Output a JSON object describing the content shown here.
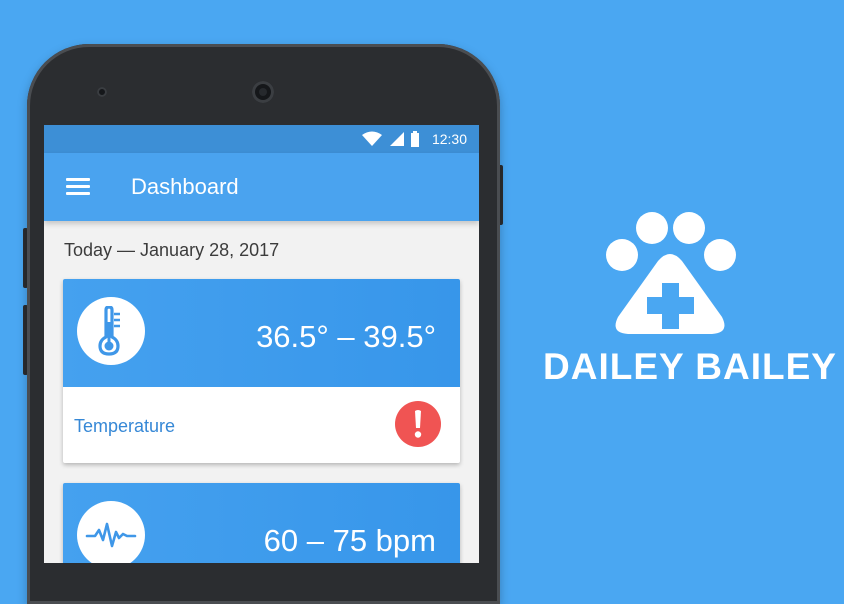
{
  "statusbar": {
    "time": "12:30",
    "icons": [
      "wifi-icon",
      "signal-icon",
      "battery-icon"
    ]
  },
  "appbar": {
    "title": "Dashboard",
    "menu_icon": "menu-icon"
  },
  "date_line": "Today — January 28, 2017",
  "cards": [
    {
      "label": "Temperature",
      "value": "36.5° – 39.5°",
      "icon": "thermometer-icon",
      "alert": true
    },
    {
      "label": "",
      "value": "60 – 75 bpm",
      "icon": "heartbeat-icon"
    }
  ],
  "brand": {
    "name": "DAILEY BAILEY",
    "logo": "paw-cross-logo"
  },
  "colors": {
    "background": "#4aa7f2",
    "appbar": "#4aa3ef",
    "statusbar": "#3d8fd6",
    "alert": "#f05453",
    "label": "#3688d6"
  }
}
